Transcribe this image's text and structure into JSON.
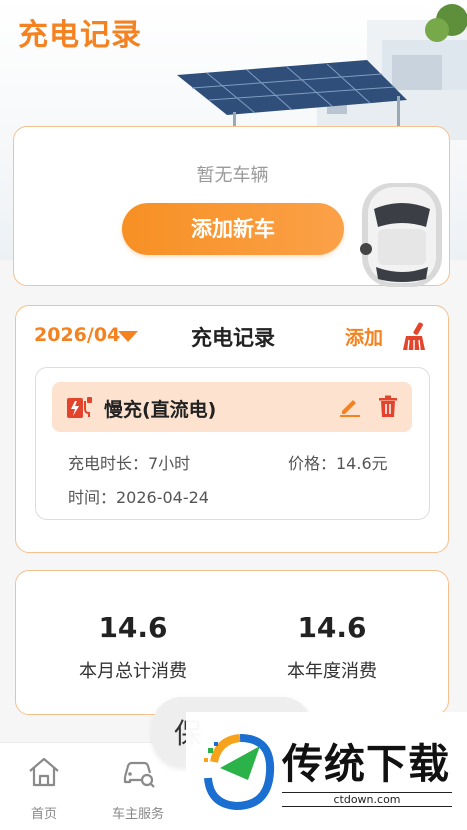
{
  "header": {
    "title": "充电记录"
  },
  "vehicle": {
    "empty_text": "暂无车辆",
    "add_button": "添加新车"
  },
  "records": {
    "month": "2026/04",
    "title": "充电记录",
    "add_label": "添加",
    "entry": {
      "type": "慢充(直流电)",
      "duration": "充电时长：7小时",
      "price": "价格：14.6元",
      "time": "时间：2026-04-24"
    }
  },
  "stats": {
    "month_value": "14.6",
    "month_label": "本月总计消费",
    "year_value": "14.6",
    "year_label": "本年度消费"
  },
  "tabbar": {
    "items": [
      {
        "label": "首页",
        "icon": "home-icon"
      },
      {
        "label": "车主服务",
        "icon": "car-service-icon"
      }
    ]
  },
  "floating": {
    "label": "保"
  },
  "watermark": {
    "text": "传统下载",
    "url": "ctdown.com"
  },
  "colors": {
    "accent": "#f58220",
    "card_border": "#f6c08f",
    "entry_bg": "#fde3cf",
    "delete": "#e2452c"
  }
}
